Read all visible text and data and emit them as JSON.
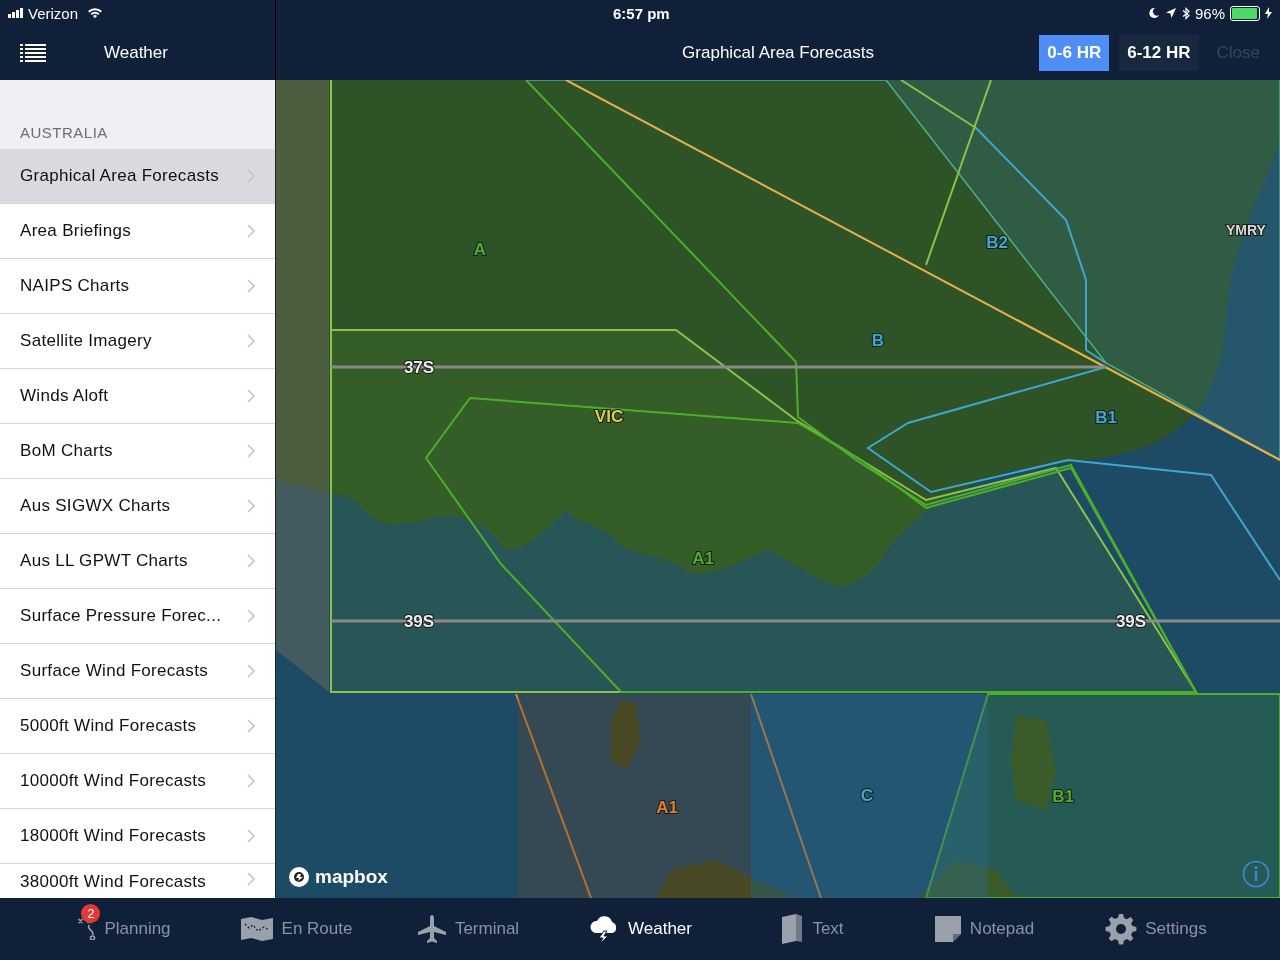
{
  "status_bar": {
    "carrier": "Verizon",
    "time": "6:57 pm",
    "battery": "96%"
  },
  "sidebar": {
    "title": "Weather",
    "section": "AUSTRALIA",
    "items": [
      {
        "label": "Graphical Area Forecasts",
        "selected": true
      },
      {
        "label": "Area Briefings",
        "selected": false
      },
      {
        "label": "NAIPS Charts",
        "selected": false
      },
      {
        "label": "Satellite Imagery",
        "selected": false
      },
      {
        "label": "Winds Aloft",
        "selected": false
      },
      {
        "label": "BoM Charts",
        "selected": false
      },
      {
        "label": "Aus SIGWX Charts",
        "selected": false
      },
      {
        "label": "Aus LL GPWT Charts",
        "selected": false
      },
      {
        "label": "Surface Pressure Forec...",
        "selected": false
      },
      {
        "label": "Surface Wind Forecasts",
        "selected": false
      },
      {
        "label": "5000ft Wind Forecasts",
        "selected": false
      },
      {
        "label": "10000ft Wind Forecasts",
        "selected": false
      },
      {
        "label": "18000ft Wind Forecasts",
        "selected": false
      },
      {
        "label": "38000ft Wind Forecasts",
        "selected": false
      }
    ]
  },
  "header": {
    "title": "Graphical Area Forecasts",
    "buttons": [
      {
        "label": "0-6 HR",
        "selected": true,
        "disabled": false
      },
      {
        "label": "6-12 HR",
        "selected": false,
        "disabled": false
      },
      {
        "label": "Close",
        "selected": false,
        "disabled": true
      }
    ]
  },
  "map": {
    "attribution": "mapbox",
    "labels": [
      {
        "text": "A",
        "kind": "area",
        "color": "#4caf2a"
      },
      {
        "text": "B2",
        "kind": "area",
        "color": "#3fa6d0"
      },
      {
        "text": "B",
        "kind": "area",
        "color": "#3fa6d0"
      },
      {
        "text": "VIC",
        "kind": "area",
        "color": "#d6d24a"
      },
      {
        "text": "B1",
        "kind": "area",
        "color": "#3fa6d0"
      },
      {
        "text": "A1",
        "kind": "area",
        "color": "#4caf2a"
      },
      {
        "text": "A1",
        "kind": "area",
        "color": "#d9822b"
      },
      {
        "text": "C",
        "kind": "area",
        "color": "#3fa6d0"
      },
      {
        "text": "B1",
        "kind": "area",
        "color": "#4caf2a"
      },
      {
        "text": "37S",
        "kind": "latitude"
      },
      {
        "text": "39S",
        "kind": "latitude"
      },
      {
        "text": "39S",
        "kind": "latitude"
      },
      {
        "text": "YMRY",
        "kind": "airport"
      }
    ]
  },
  "tabs": [
    {
      "label": "Planning",
      "kind": "planning",
      "selected": false,
      "badge": "2"
    },
    {
      "label": "En Route",
      "kind": "enroute",
      "selected": false
    },
    {
      "label": "Terminal",
      "kind": "terminal",
      "selected": false
    },
    {
      "label": "Weather",
      "kind": "weather",
      "selected": true
    },
    {
      "label": "Text",
      "kind": "text",
      "selected": false
    },
    {
      "label": "Notepad",
      "kind": "notepad",
      "selected": false
    },
    {
      "label": "Settings",
      "kind": "settings",
      "selected": false
    }
  ]
}
